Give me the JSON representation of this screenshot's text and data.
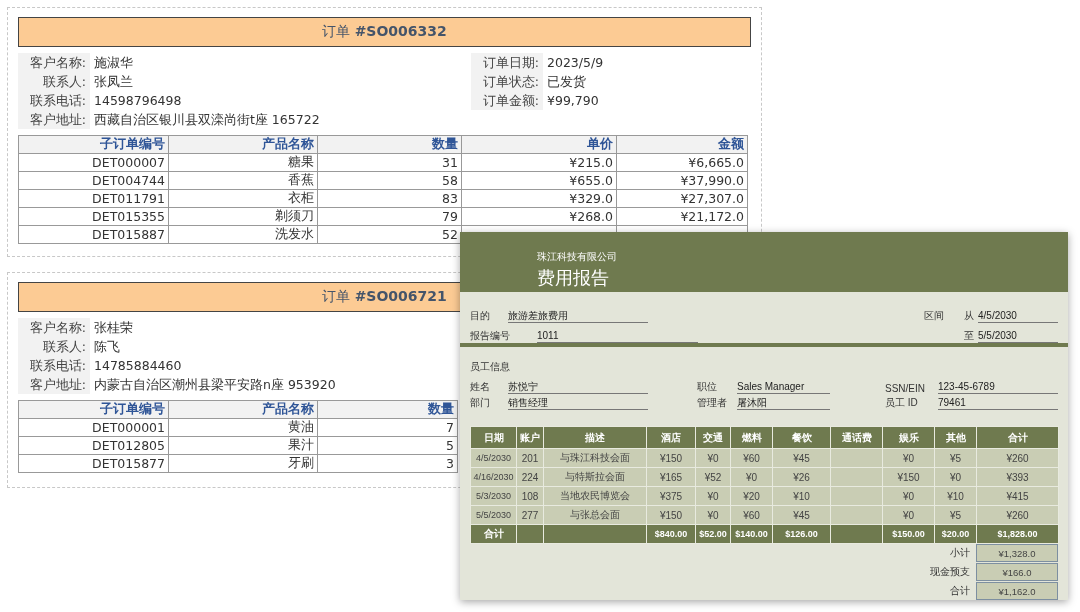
{
  "orders": [
    {
      "title": "订单 **#SO006332**",
      "fields_left": [
        {
          "label": "客户名称:",
          "value": "施淑华"
        },
        {
          "label": "联系人:",
          "value": "张凤兰"
        },
        {
          "label": "联系电话:",
          "value": "14598796498"
        },
        {
          "label": "客户地址:",
          "value": "西藏自治区银川县双滦尚街t座 165722"
        }
      ],
      "fields_right": [
        {
          "label": "订单日期:",
          "value": "2023/5/9"
        },
        {
          "label": "订单状态:",
          "value": "已发货"
        },
        {
          "label": "订单金额:",
          "value": "¥99,790"
        }
      ],
      "columns": [
        "子订单编号",
        "产品名称",
        "数量",
        "单价",
        "金额"
      ],
      "rows": [
        [
          "DET000007",
          "糖果",
          "31",
          "¥215.0",
          "¥6,665.0"
        ],
        [
          "DET004744",
          "香蕉",
          "58",
          "¥655.0",
          "¥37,990.0"
        ],
        [
          "DET011791",
          "衣柜",
          "83",
          "¥329.0",
          "¥27,307.0"
        ],
        [
          "DET015355",
          "剃须刀",
          "79",
          "¥268.0",
          "¥21,172.0"
        ],
        [
          "DET015887",
          "洗发水",
          "52"
        ]
      ]
    },
    {
      "title": "订单 **#SO006721**",
      "fields_left": [
        {
          "label": "客户名称:",
          "value": "张桂荣"
        },
        {
          "label": "联系人:",
          "value": "陈飞"
        },
        {
          "label": "联系电话:",
          "value": "14785884460"
        },
        {
          "label": "客户地址:",
          "value": "内蒙古自治区潮州县梁平安路n座 953920"
        }
      ],
      "columns": [
        "子订单编号",
        "产品名称",
        "数量"
      ],
      "rows": [
        [
          "DET000001",
          "黄油",
          "7"
        ],
        [
          "DET012805",
          "果汁",
          "5"
        ],
        [
          "DET015877",
          "牙刷",
          "3"
        ]
      ]
    }
  ],
  "expense_report": {
    "company": "珠江科技有限公司",
    "title": "费用报告",
    "purpose": {
      "label": "目的",
      "value": "旅游差旅费用"
    },
    "report_no": {
      "label": "报告编号",
      "value": "1011"
    },
    "period": {
      "label": "区间",
      "from_label": "从",
      "from": "4/5/2030",
      "to_label": "至",
      "to": "5/5/2030"
    },
    "section_title": "员工信息",
    "employee_fields": [
      {
        "label": "姓名",
        "value": "苏悦宁"
      },
      {
        "label": "职位",
        "value": "Sales Manager"
      },
      {
        "label": "SSN/EIN",
        "value": "123-45-6789"
      },
      {
        "label": "部门",
        "value": "销售经理"
      },
      {
        "label": "管理者",
        "value": "屠沐阳"
      },
      {
        "label": "员工 ID",
        "value": "79461"
      }
    ],
    "columns": [
      "日期",
      "账户",
      "描述",
      "酒店",
      "交通",
      "燃料",
      "餐饮",
      "通话费",
      "娱乐",
      "其他",
      "合计"
    ],
    "rows": [
      [
        "4/5/2030",
        "201",
        "与珠江科技会面",
        "¥150",
        "¥0",
        "¥60",
        "¥45",
        "",
        "¥0",
        "¥5",
        "¥260"
      ],
      [
        "4/16/2030",
        "224",
        "与特斯拉会面",
        "¥165",
        "¥52",
        "¥0",
        "¥26",
        "",
        "¥150",
        "¥0",
        "¥393"
      ],
      [
        "5/3/2030",
        "108",
        "当地农民博览会",
        "¥375",
        "¥0",
        "¥20",
        "¥10",
        "",
        "¥0",
        "¥10",
        "¥415"
      ],
      [
        "5/5/2030",
        "277",
        "与张总会面",
        "¥150",
        "¥0",
        "¥60",
        "¥45",
        "",
        "¥0",
        "¥5",
        "¥260"
      ]
    ],
    "total_row": {
      "label": "合计",
      "values": [
        "$840.00",
        "$52.00",
        "$140.00",
        "$126.00",
        "$150.00",
        "$20.00",
        "$1,828.00"
      ]
    },
    "summary": [
      {
        "label": "小计",
        "value": "¥1,328.0"
      },
      {
        "label": "现金预支",
        "value": "¥166.0"
      },
      {
        "label": "合计",
        "value": "¥1,162.0"
      }
    ]
  }
}
